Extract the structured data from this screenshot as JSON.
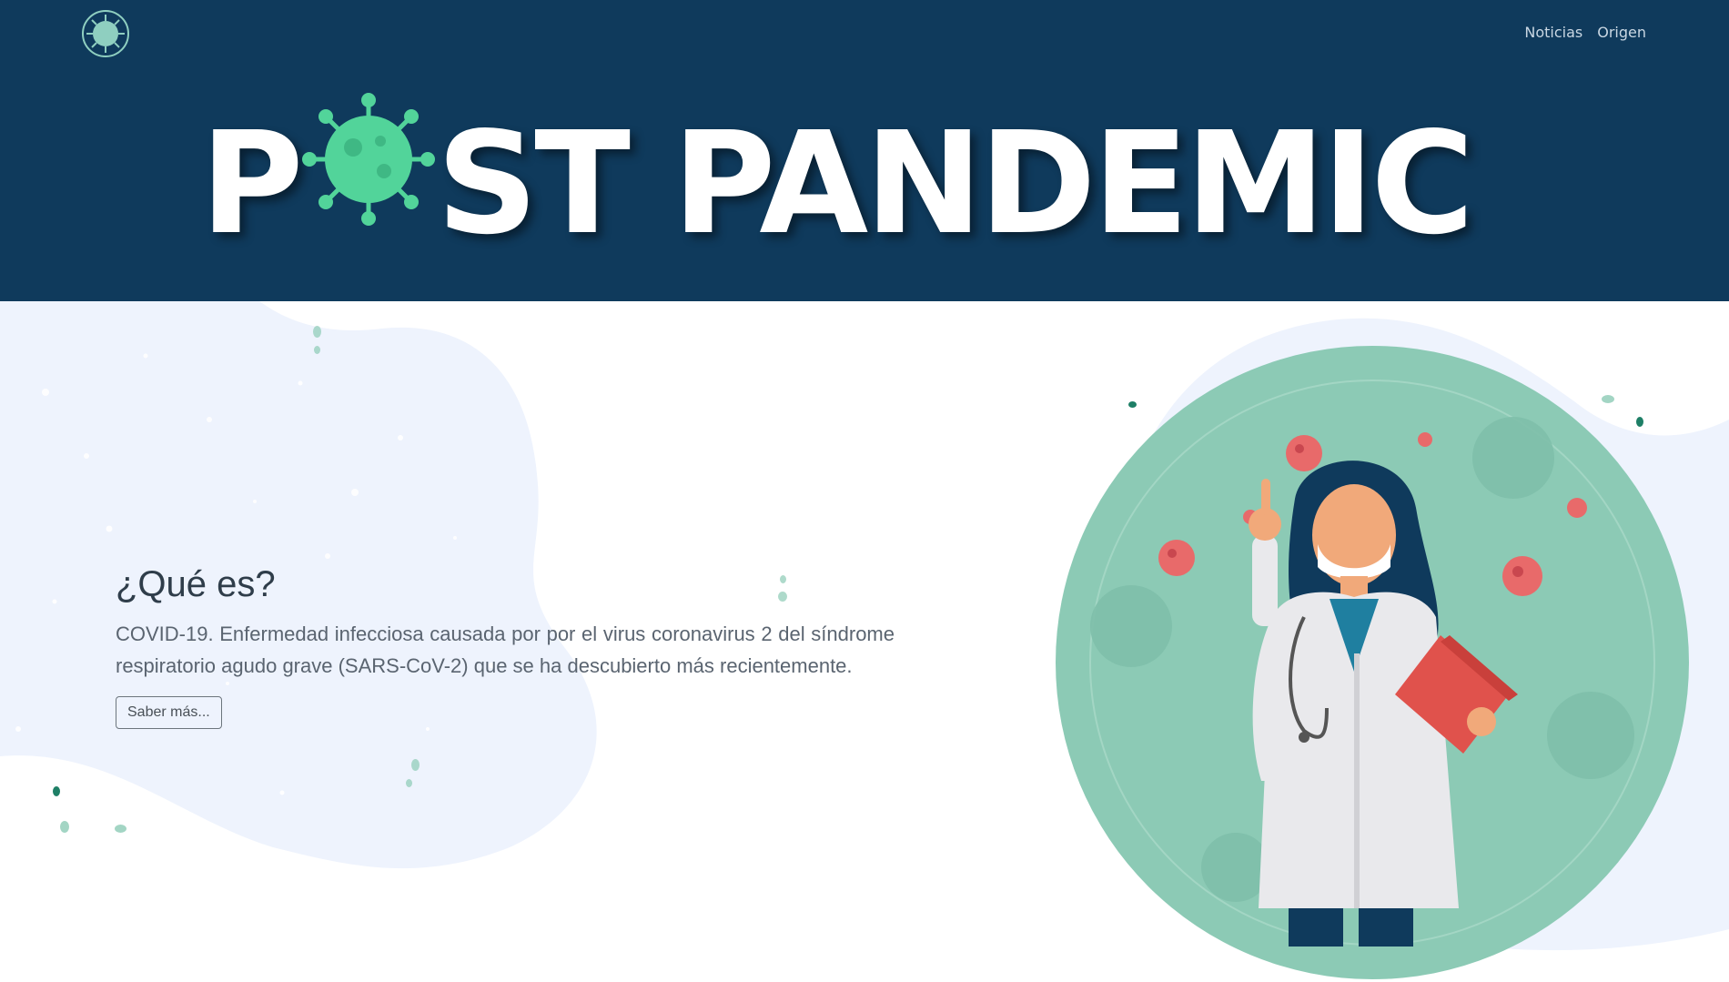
{
  "navbar": {
    "logo_icon": "virus-logo-icon",
    "links": [
      {
        "label": "Noticias"
      },
      {
        "label": "Origen"
      }
    ]
  },
  "banner": {
    "title_prefix": "P",
    "title_suffix": "ST PANDEMIC",
    "o_icon": "virus-icon",
    "background": "#0f3a5c"
  },
  "hero": {
    "heading": "¿Qué es?",
    "description": "COVID-19. Enfermedad infecciosa causada por por el virus coronavirus 2 del síndrome respiratorio agudo grave (SARS-CoV-2) que se ha descubierto más recientemente.",
    "button_label": "Saber más..."
  },
  "illustration": {
    "subject": "doctor-with-mask-illustration",
    "accent": "#8ccab5",
    "virus_color": "#e86a6a"
  }
}
